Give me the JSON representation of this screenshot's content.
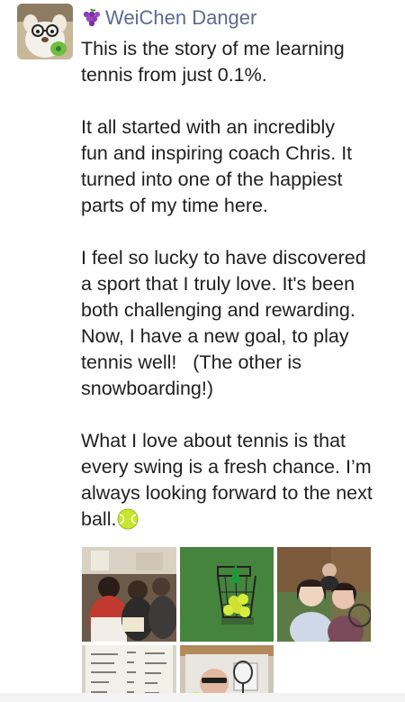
{
  "post": {
    "author": "WeiChen Danger",
    "author_icon": "grape-icon",
    "paragraphs": [
      [
        "This is the story of me learning",
        "tennis from just 0.1%."
      ],
      [
        "It all started with an incredibly",
        "fun and inspiring coach Chris. It",
        "turned into one of the happiest",
        "parts of my time here."
      ],
      [
        "I feel so lucky to have discovered",
        "a sport that I truly love. It's been",
        "both challenging and rewarding.",
        "Now, I have a new goal, to play",
        "tennis well!   (The other is",
        "snowboarding!)"
      ],
      [
        "What I love about tennis is that",
        "every swing is a fresh chance. I’m",
        "always looking forward to the next",
        "ball."
      ]
    ],
    "end_icon": "tennis-ball-icon",
    "photos": [
      "group-dinner-photo",
      "tennis-ball-basket-photo",
      "selfie-tennis-court-photo",
      "handwritten-notes-photo",
      "coach-selfie-photo"
    ],
    "colors": {
      "author": "#5b6a92",
      "text": "#1f1f1f",
      "background": "#ffffff"
    }
  }
}
